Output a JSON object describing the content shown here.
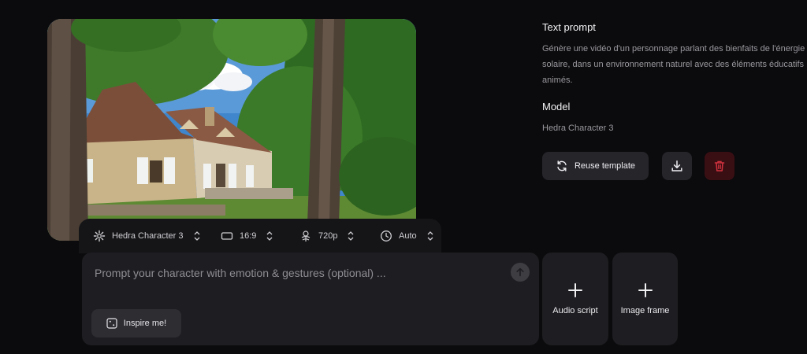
{
  "preview": {
    "colors": {
      "sky": "#4a86c4",
      "foliage": "#3f7a2a",
      "roof": "#7b4e3a",
      "wall": "#c8b58a"
    }
  },
  "settings": {
    "model": "Hedra Character 3",
    "aspect_ratio": "16:9",
    "resolution": "720p",
    "duration": "Auto"
  },
  "prompt": {
    "placeholder": "Prompt your character with emotion & gestures (optional) ...",
    "inspire_label": "Inspire me!"
  },
  "tiles": {
    "audio_label": "Audio script",
    "image_label": "Image frame"
  },
  "details": {
    "text_prompt_heading": "Text prompt",
    "text_prompt_value": "Génère une vidéo d'un personnage parlant des bienfaits de l'énergie solaire, dans un environnement naturel avec des éléments éducatifs animés.",
    "model_heading": "Model",
    "model_value": "Hedra Character 3",
    "reuse_label": "Reuse template"
  },
  "colors": {
    "background": "#0b0a0c",
    "panel": "#1e1d21",
    "delete_bg": "#3a0f14",
    "delete_icon": "#d2323e"
  }
}
